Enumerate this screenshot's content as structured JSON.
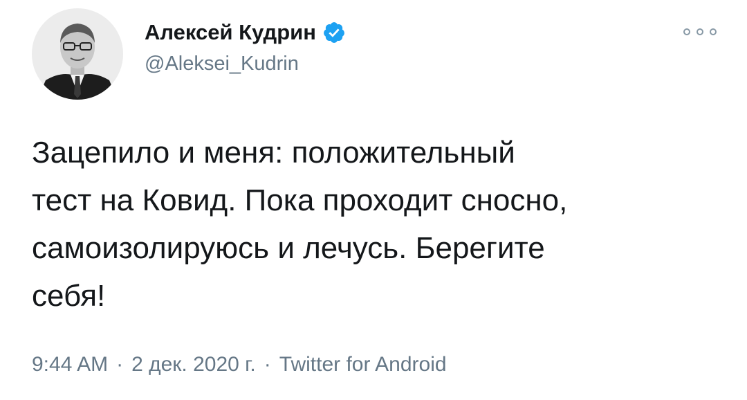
{
  "author": {
    "display_name": "Алексей Кудрин",
    "handle": "@Aleksei_Kudrin",
    "avatar_icon": "person-portrait-avatar",
    "verified_icon": "verified-badge-icon"
  },
  "menu": {
    "icon": "more-options-icon"
  },
  "tweet": {
    "text": "Зацепило и меня: положительный\nтест на Ковид. Пока проходит сносно,\nсамоизолируюсь и лечусь. Берегите\nсебя!"
  },
  "meta": {
    "time": "9:44 AM",
    "separator_1": "·",
    "date": "2 дек. 2020 г.",
    "separator_2": "·",
    "source": "Twitter for Android"
  },
  "colors": {
    "verified_blue": "#1da1f2",
    "text": "#14171a",
    "muted": "#657786"
  }
}
